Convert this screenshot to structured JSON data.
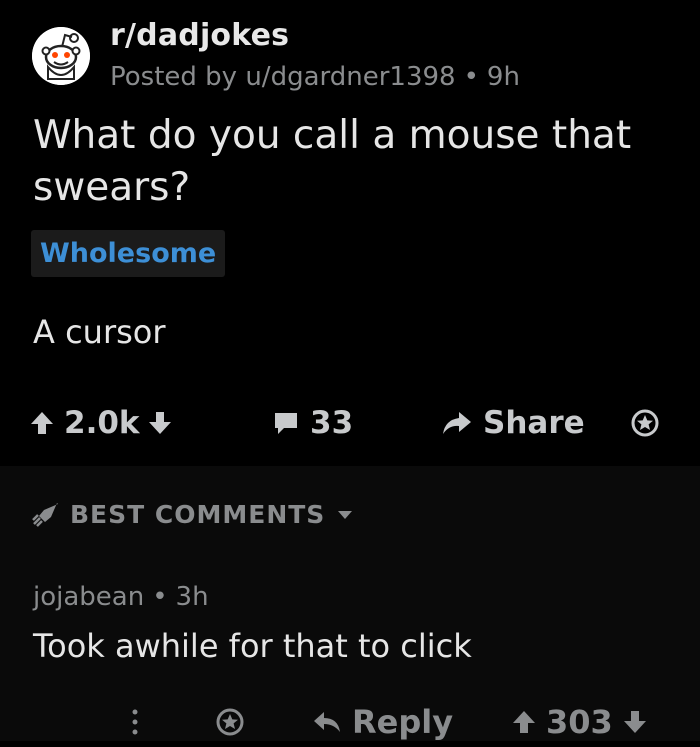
{
  "post": {
    "subreddit": "r/dadjokes",
    "posted_by_prefix": "Posted by",
    "author": "u/dgardner1398",
    "age": "9h",
    "title": "What do you call a mouse that swears?",
    "flair": "Wholesome",
    "body": "A cursor",
    "upvotes": "2.0k",
    "comments": "33",
    "share_label": "Share"
  },
  "comments_header": {
    "sort_label": "BEST COMMENTS"
  },
  "comment": {
    "author": "jojabean",
    "age": "3h",
    "body": "Took awhile for that to click",
    "reply_label": "Reply",
    "score": "303"
  },
  "colors": {
    "background": "#000000",
    "flair_text": "#3d8fd6",
    "muted_text": "#8a8c8e",
    "main_text": "#e6e6e6"
  }
}
